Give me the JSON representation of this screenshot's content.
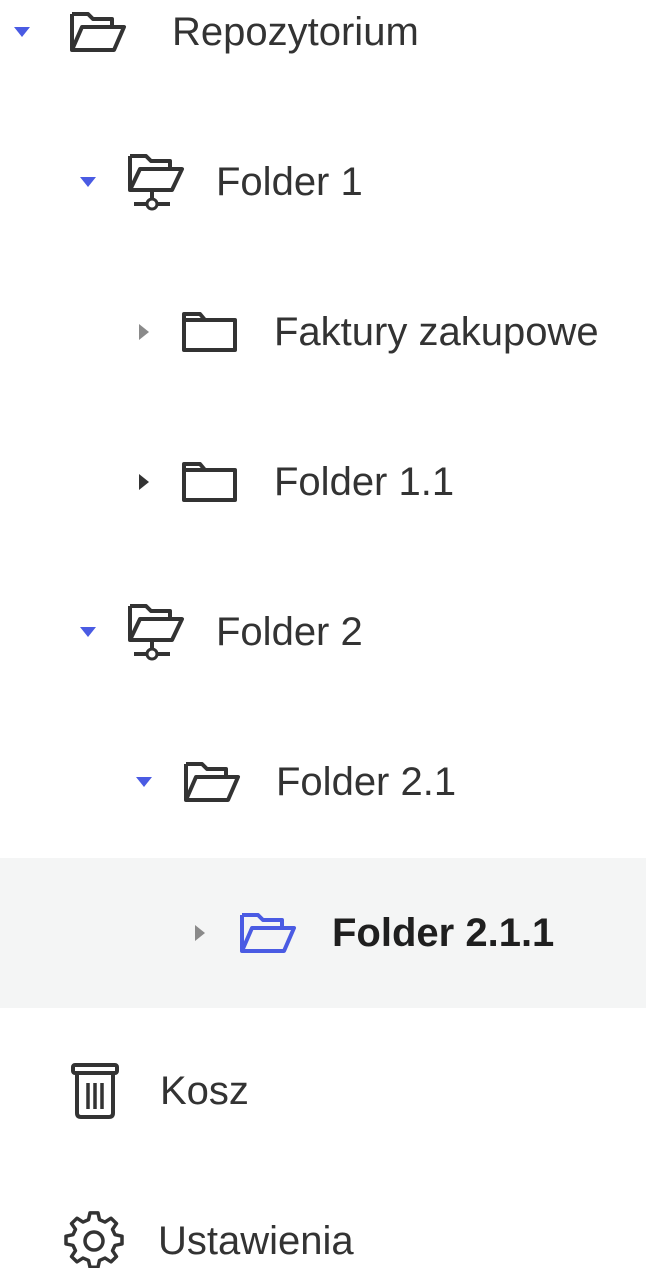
{
  "colors": {
    "accent": "#4a5be3",
    "text": "#333333",
    "icon": "#333333",
    "selected_bg": "#f4f5f5"
  },
  "tree": {
    "root": {
      "label": "Repozytorium",
      "expanded": true,
      "icon": "folder-open-icon"
    },
    "folder1": {
      "label": "Folder 1",
      "expanded": true,
      "icon": "network-folder-open-icon"
    },
    "faktury": {
      "label": "Faktury zakupowe",
      "expanded": false,
      "icon": "folder-icon"
    },
    "folder11": {
      "label": "Folder 1.1",
      "expanded": false,
      "icon": "folder-icon"
    },
    "folder2": {
      "label": "Folder 2",
      "expanded": true,
      "icon": "network-folder-open-icon"
    },
    "folder21": {
      "label": "Folder 2.1",
      "expanded": true,
      "icon": "folder-open-icon"
    },
    "folder211": {
      "label": "Folder 2.1.1",
      "expanded": false,
      "selected": true,
      "icon": "folder-open-icon"
    }
  },
  "footer": {
    "trash": {
      "label": "Kosz",
      "icon": "trash-icon"
    },
    "settings": {
      "label": "Ustawienia",
      "icon": "gear-icon"
    }
  }
}
